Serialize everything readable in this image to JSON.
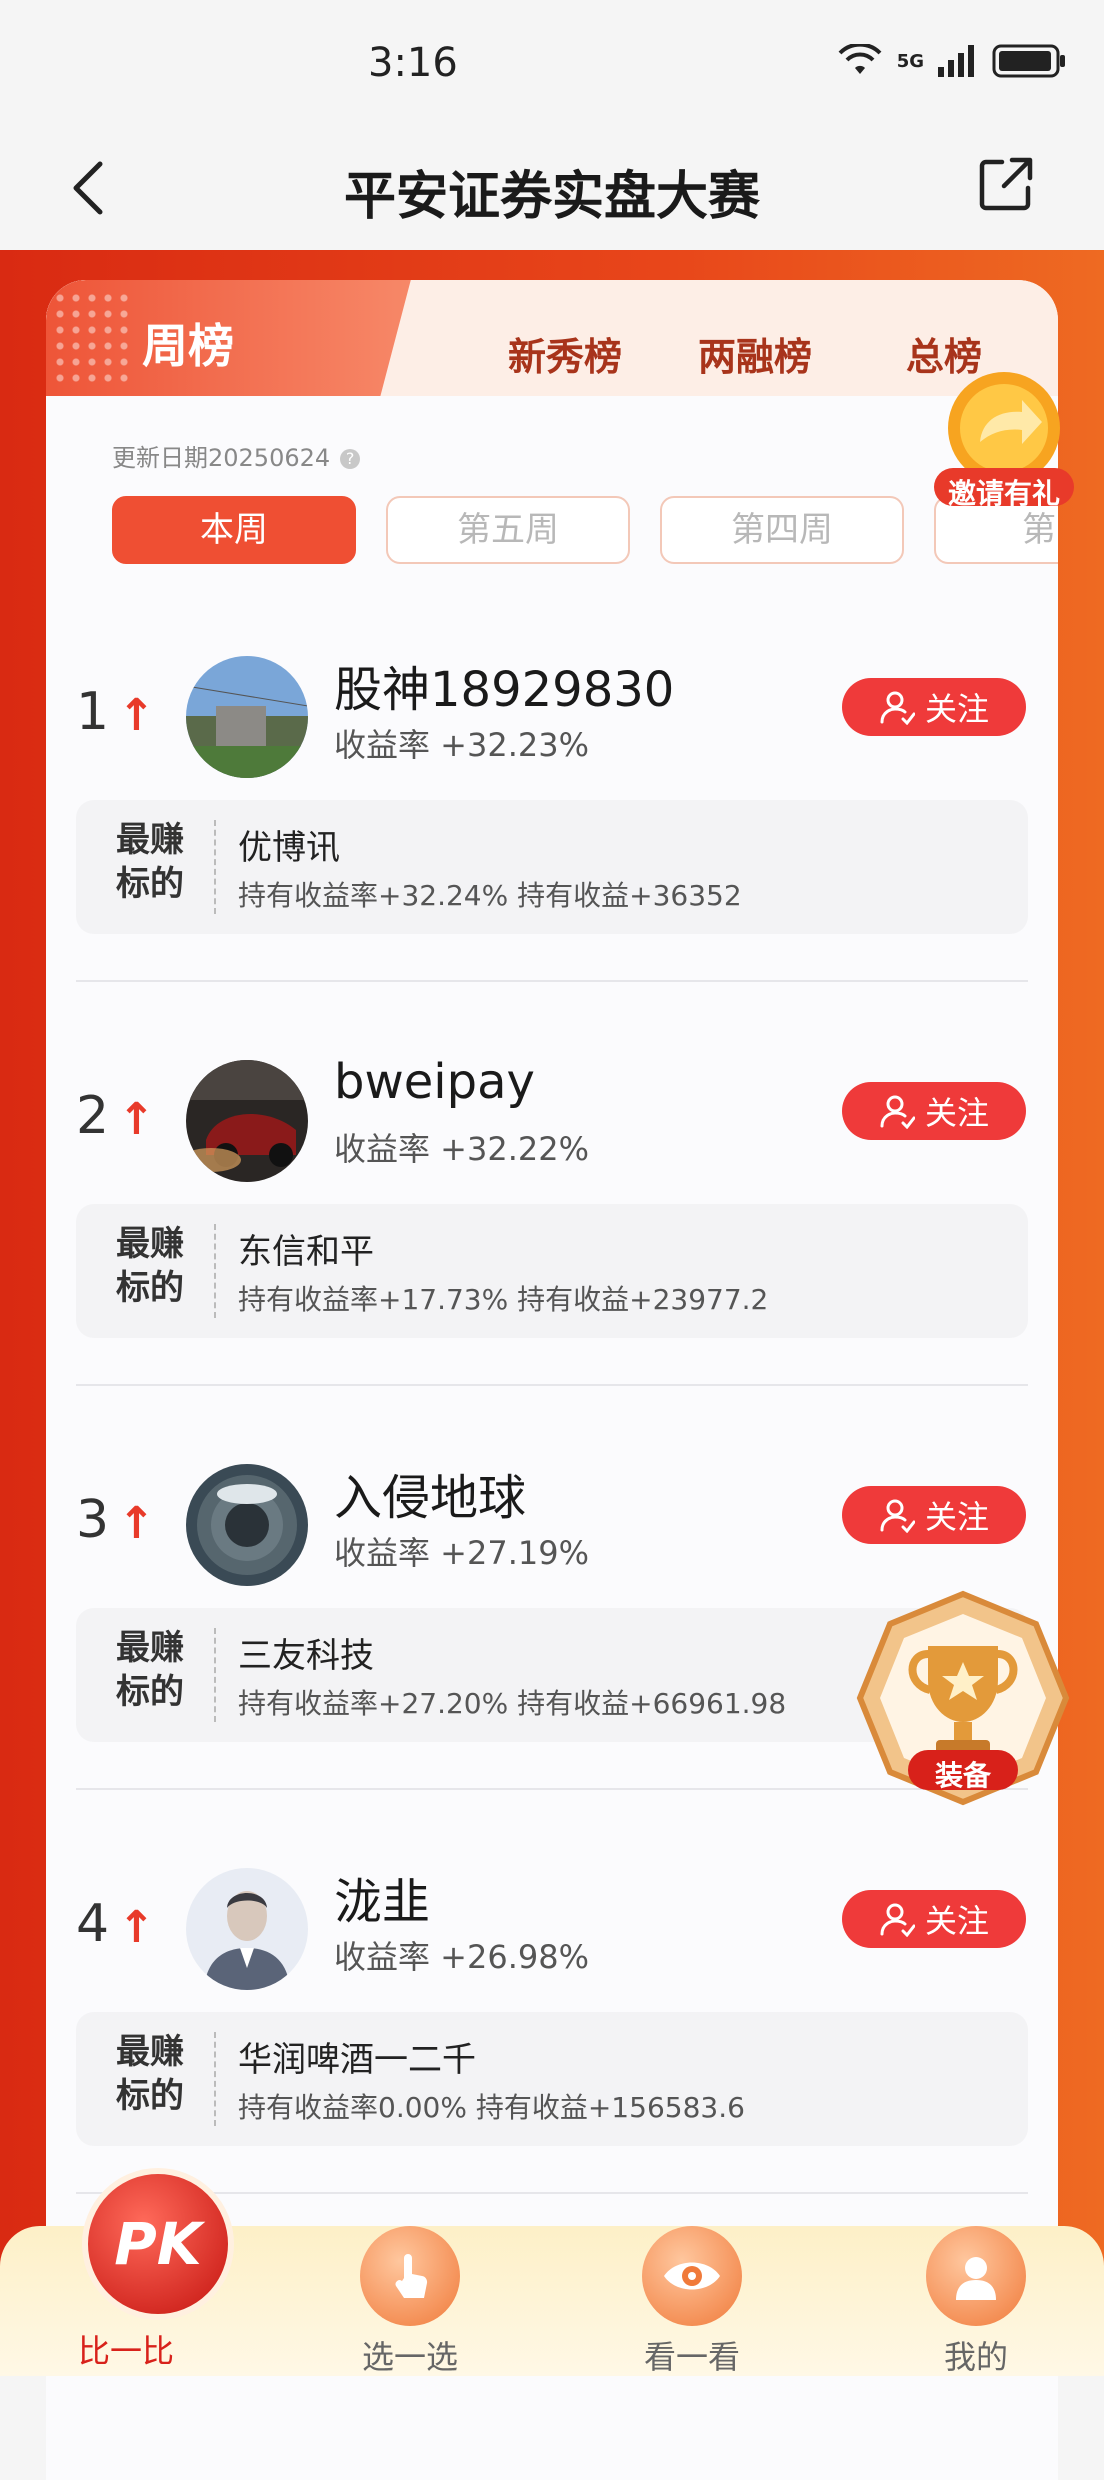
{
  "status": {
    "time": "3:16",
    "network": "5G"
  },
  "nav": {
    "title": "平安证券实盘大赛"
  },
  "tabs": [
    {
      "label": "周榜"
    },
    {
      "label": "新秀榜"
    },
    {
      "label": "两融榜"
    },
    {
      "label": "总榜"
    }
  ],
  "update_date": "更新日期20250624",
  "weeks": [
    "本周",
    "第五周",
    "第四周",
    "第三"
  ],
  "invite_label": "邀请有礼",
  "trophy_label": "装备",
  "entries": [
    {
      "rank": "1",
      "arrow": "↑",
      "name": "股神18929830",
      "return": "收益率 +32.23%",
      "follow": "关注",
      "best_label": "最赚标的",
      "stock": "优博讯",
      "detail": "持有收益率+32.24% 持有收益+36352"
    },
    {
      "rank": "2",
      "arrow": "↑",
      "name": "bweipay",
      "return": "收益率 +32.22%",
      "follow": "关注",
      "best_label": "最赚标的",
      "stock": "东信和平",
      "detail": "持有收益率+17.73% 持有收益+23977.2"
    },
    {
      "rank": "3",
      "arrow": "↑",
      "name": "入侵地球",
      "return": "收益率 +27.19%",
      "follow": "关注",
      "best_label": "最赚标的",
      "stock": "三友科技",
      "detail": "持有收益率+27.20% 持有收益+66961.98"
    },
    {
      "rank": "4",
      "arrow": "↑",
      "name": "泷韭",
      "return": "收益率 +26.98%",
      "follow": "关注",
      "best_label": "最赚标的",
      "stock": "华润啤酒一二千",
      "detail": "持有收益率0.00% 持有收益+156583.6"
    }
  ],
  "bottom_nav": [
    {
      "label": "比一比",
      "icon": "pk-icon"
    },
    {
      "label": "选一选",
      "icon": "tap-hand-icon"
    },
    {
      "label": "看一看",
      "icon": "eye-icon"
    },
    {
      "label": "我的",
      "icon": "user-icon"
    }
  ],
  "bottom_nav_pk_text": "PK",
  "colors": {
    "accent": "#ef3a3a",
    "brand_orange": "#e8461a",
    "tab_text": "#a8341b"
  }
}
